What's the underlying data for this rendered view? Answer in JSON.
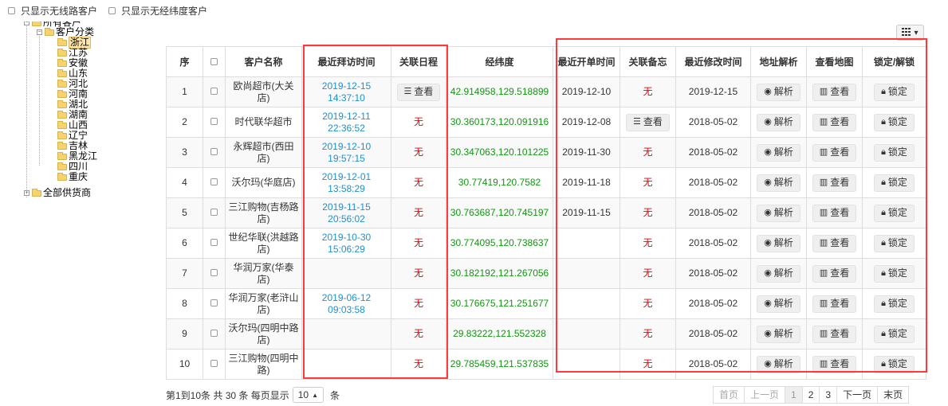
{
  "filters": {
    "wireless_label": "只显示无线路客户",
    "nolatlng_label": "只显示无经纬度客户"
  },
  "tree": {
    "root_label": "所有客户",
    "category_label": "客户分类",
    "provinces": [
      "浙江",
      "江苏",
      "安徽",
      "山东",
      "河北",
      "河南",
      "湖北",
      "湖南",
      "山西",
      "辽宁",
      "吉林",
      "黑龙江",
      "四川",
      "重庆"
    ],
    "suppliers_label": "全部供货商"
  },
  "table": {
    "headers": {
      "seq": "序",
      "name": "客户名称",
      "last_visit": "最近拜访时间",
      "schedule": "关联日程",
      "latlng": "经纬度",
      "last_order": "最近开单时间",
      "memo": "关联备忘",
      "last_modified": "最近修改时间",
      "address": "地址解析",
      "map": "查看地图",
      "lock": "锁定/解锁"
    },
    "rows": [
      {
        "seq": "1",
        "name": "欧尚超市(大关店)",
        "visit": "2019-12-15 14:37:10",
        "schedule": "查看",
        "latlng": "42.914958,129.518899",
        "order": "2019-12-10",
        "memo": "无",
        "modified": "2019-12-15"
      },
      {
        "seq": "2",
        "name": "时代联华超市",
        "visit": "2019-12-11 22:36:52",
        "schedule": "无",
        "latlng": "30.360173,120.091916",
        "order": "2019-12-08",
        "memo": "查看",
        "modified": "2018-05-02"
      },
      {
        "seq": "3",
        "name": "永辉超市(西田店)",
        "visit": "2019-12-10 19:57:15",
        "schedule": "无",
        "latlng": "30.347063,120.101225",
        "order": "2019-11-30",
        "memo": "无",
        "modified": "2018-05-02"
      },
      {
        "seq": "4",
        "name": "沃尔玛(华庭店)",
        "visit": "2019-12-01 13:58:29",
        "schedule": "无",
        "latlng": "30.77419,120.7582",
        "order": "2019-11-18",
        "memo": "无",
        "modified": "2018-05-02"
      },
      {
        "seq": "5",
        "name": "三江购物(吉杨路店)",
        "visit": "2019-11-15 20:56:02",
        "schedule": "无",
        "latlng": "30.763687,120.745197",
        "order": "2019-11-15",
        "memo": "无",
        "modified": "2018-05-02"
      },
      {
        "seq": "6",
        "name": "世纪华联(洪越路店)",
        "visit": "2019-10-30 15:06:29",
        "schedule": "无",
        "latlng": "30.774095,120.738637",
        "order": "",
        "memo": "无",
        "modified": "2018-05-02"
      },
      {
        "seq": "7",
        "name": "华润万家(华泰店)",
        "visit": "",
        "schedule": "无",
        "latlng": "30.182192,121.267056",
        "order": "",
        "memo": "无",
        "modified": "2018-05-02"
      },
      {
        "seq": "8",
        "name": "华润万家(老浒山店)",
        "visit": "2019-06-12 09:03:58",
        "schedule": "无",
        "latlng": "30.176675,121.251677",
        "order": "",
        "memo": "无",
        "modified": "2018-05-02"
      },
      {
        "seq": "9",
        "name": "沃尔玛(四明中路店)",
        "visit": "",
        "schedule": "无",
        "latlng": "29.83222,121.552328",
        "order": "",
        "memo": "无",
        "modified": "2018-05-02"
      },
      {
        "seq": "10",
        "name": "三江购物(四明中路)",
        "visit": "",
        "schedule": "无",
        "latlng": "29.785459,121.537835",
        "order": "",
        "memo": "无",
        "modified": "2018-05-02"
      }
    ],
    "action_labels": {
      "parse": "解析",
      "view": "查看",
      "lock": "锁定"
    }
  },
  "footer": {
    "summary": "第1到10条 共 30 条 每页显示",
    "page_size": "10",
    "unit": "条"
  },
  "pager": {
    "first": "首页",
    "prev": "上一页",
    "pages": [
      "1",
      "2",
      "3"
    ],
    "next": "下一页",
    "last": "末页"
  },
  "icons": {
    "checkbox": "checkbox-icon",
    "list": "list-icon",
    "globe": "globe-icon",
    "map": "map-icon",
    "lock": "lock-icon",
    "columns": "columns-icon"
  },
  "colors": {
    "highlight": "#ff3a3a",
    "link_blue": "#1e8fd5",
    "latlng_green": "#129612",
    "none_red": "#e60000"
  }
}
